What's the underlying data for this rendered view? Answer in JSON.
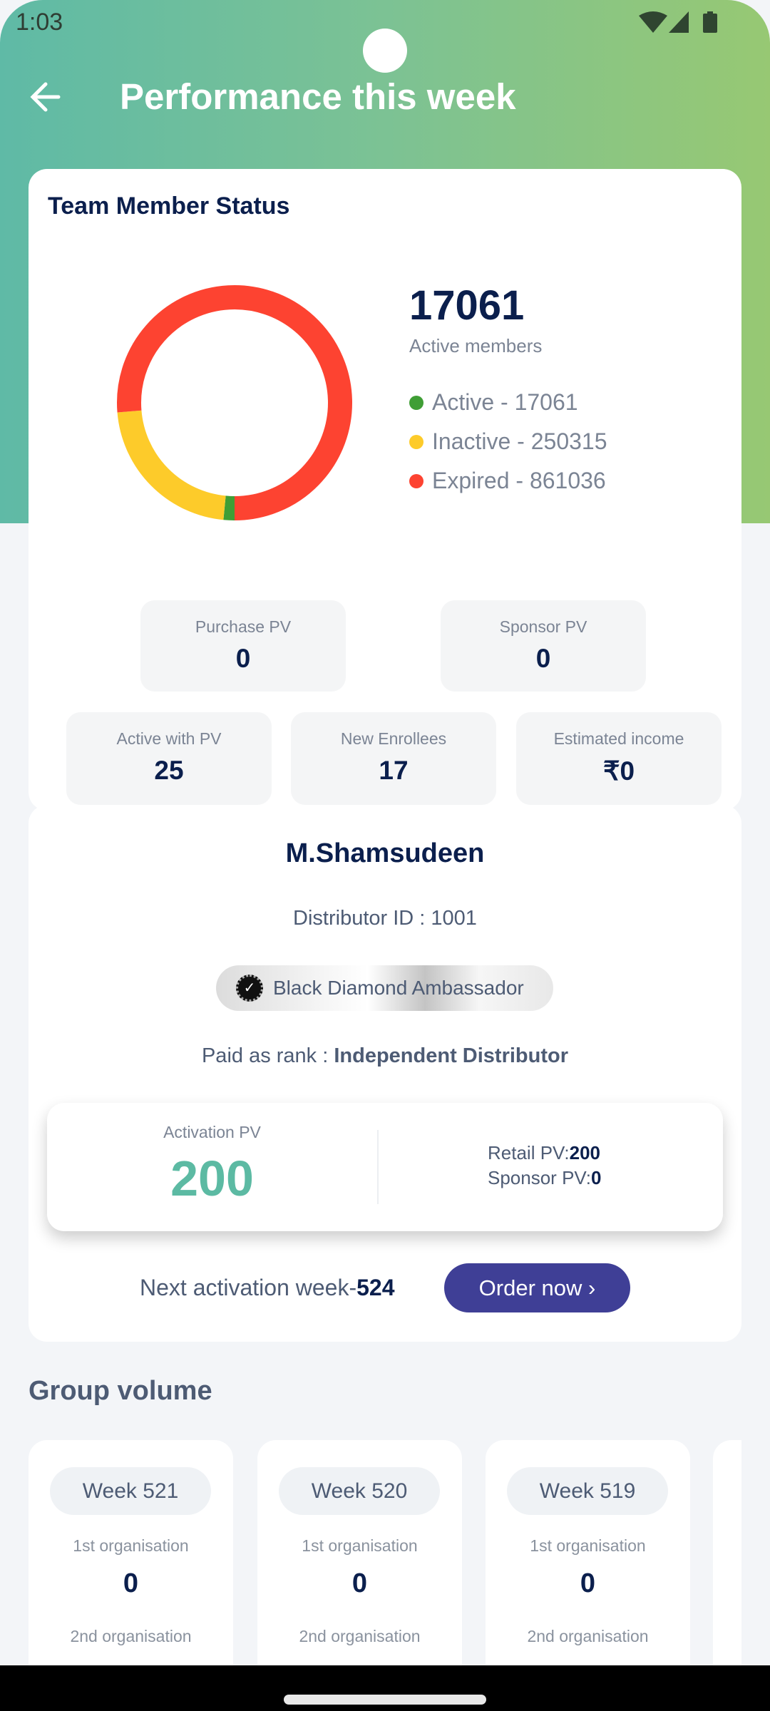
{
  "status_bar": {
    "time": "1:03",
    "icons": [
      "wifi-icon",
      "signal-icon",
      "battery-icon"
    ]
  },
  "header": {
    "title": "Performance this week",
    "back_icon": "arrow-left-icon"
  },
  "team_status": {
    "title": "Team Member Status",
    "headline_value": "17061",
    "headline_label": "Active members",
    "legend": [
      {
        "label": "Active - 17061",
        "color": "#3f9e35"
      },
      {
        "label": "Inactive - 250315",
        "color": "#fdcb2a"
      },
      {
        "label": "Expired - 861036",
        "color": "#fd4331"
      }
    ],
    "stats": [
      {
        "label": "Purchase PV",
        "value": "0"
      },
      {
        "label": "Sponsor PV",
        "value": "0"
      },
      {
        "label": "Active with PV",
        "value": "25"
      },
      {
        "label": "New Enrollees",
        "value": "17"
      },
      {
        "label": "Estimated income",
        "value": "₹0"
      }
    ]
  },
  "chart_data": {
    "type": "pie",
    "variant": "donut",
    "categories": [
      "Active",
      "Inactive",
      "Expired"
    ],
    "values": [
      17061,
      250315,
      861036
    ],
    "colors": [
      "#3f9e35",
      "#fdcb2a",
      "#fd4331"
    ]
  },
  "profile": {
    "name": "M.Shamsudeen",
    "distributor_id": "Distributor ID : 1001",
    "rank_badge": "Black Diamond Ambassador",
    "paid_as_prefix": "Paid as rank : ",
    "paid_as_rank": "Independent Distributor",
    "activation_label": "Activation PV",
    "activation_value": "200",
    "retail_label": "Retail PV:",
    "retail_value": "200",
    "sponsor_label": "Sponsor PV:",
    "sponsor_value": "0",
    "next_activation_prefix": "Next activation week-",
    "next_activation_week": "524",
    "order_button": "Order now ›",
    "accent": "#3f3f96"
  },
  "group_volume": {
    "title": "Group volume",
    "weeks": [
      {
        "label": "Week 521",
        "org1_label": "1st organisation",
        "org1_value": "0",
        "org2_label": "2nd organisation"
      },
      {
        "label": "Week 520",
        "org1_label": "1st organisation",
        "org1_value": "0",
        "org2_label": "2nd organisation"
      },
      {
        "label": "Week 519",
        "org1_label": "1st organisation",
        "org1_value": "0",
        "org2_label": "2nd organisation"
      }
    ]
  }
}
